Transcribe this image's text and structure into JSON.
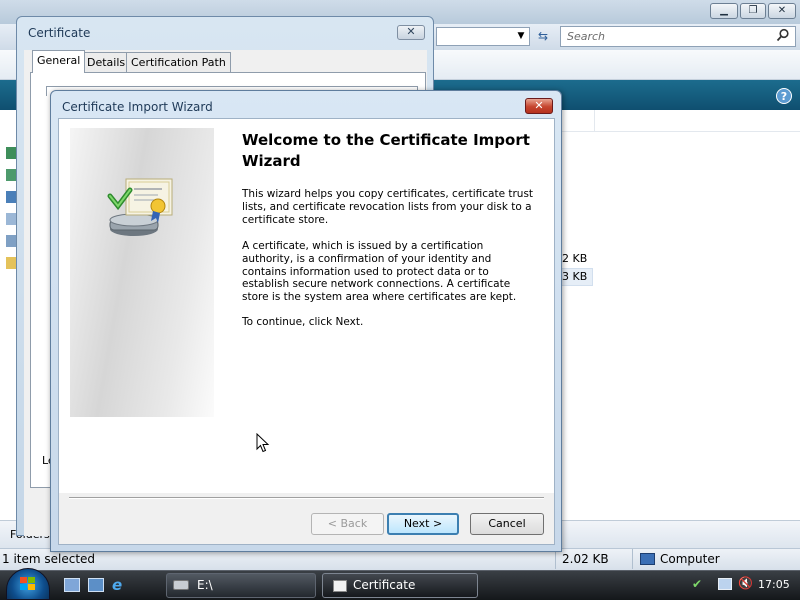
{
  "explorer": {
    "search_placeholder": "Search",
    "file_sizes": [
      "2 KB",
      "3 KB"
    ],
    "folders_label": "Folders",
    "status_left": "1 item selected",
    "status_size": "2.02 KB",
    "status_location": "Computer",
    "help_glyph": "?"
  },
  "cert_window": {
    "title": "Certificate",
    "close_glyph": "✕",
    "tabs": [
      "General",
      "Details",
      "Certification Path"
    ],
    "partial_label": "Le"
  },
  "wizard": {
    "title": "Certificate Import Wizard",
    "close_glyph": "✕",
    "heading": "Welcome to the Certificate Import Wizard",
    "paragraph1": "This wizard helps you copy certificates, certificate trust lists, and certificate revocation lists from your disk to a certificate store.",
    "paragraph2": "A certificate, which is issued by a certification authority, is a confirmation of your identity and contains information used to protect data or to establish secure network connections. A certificate store is the system area where certificates are kept.",
    "paragraph3": "To continue, click Next.",
    "back_label": "< Back",
    "next_label": "Next >",
    "cancel_label": "Cancel",
    "icon": "certificate-import-icon"
  },
  "taskbar": {
    "items": [
      {
        "label": "E:\\",
        "icon": "drive-icon"
      },
      {
        "label": "Certificate",
        "icon": "certificate-icon"
      }
    ],
    "clock": "17:05"
  },
  "colors": {
    "wizard_title_bg": "#c7d8ea",
    "close_red": "#c6452f",
    "next_focus": "#3c7fb1",
    "taskbar_bg": "#23282e"
  }
}
